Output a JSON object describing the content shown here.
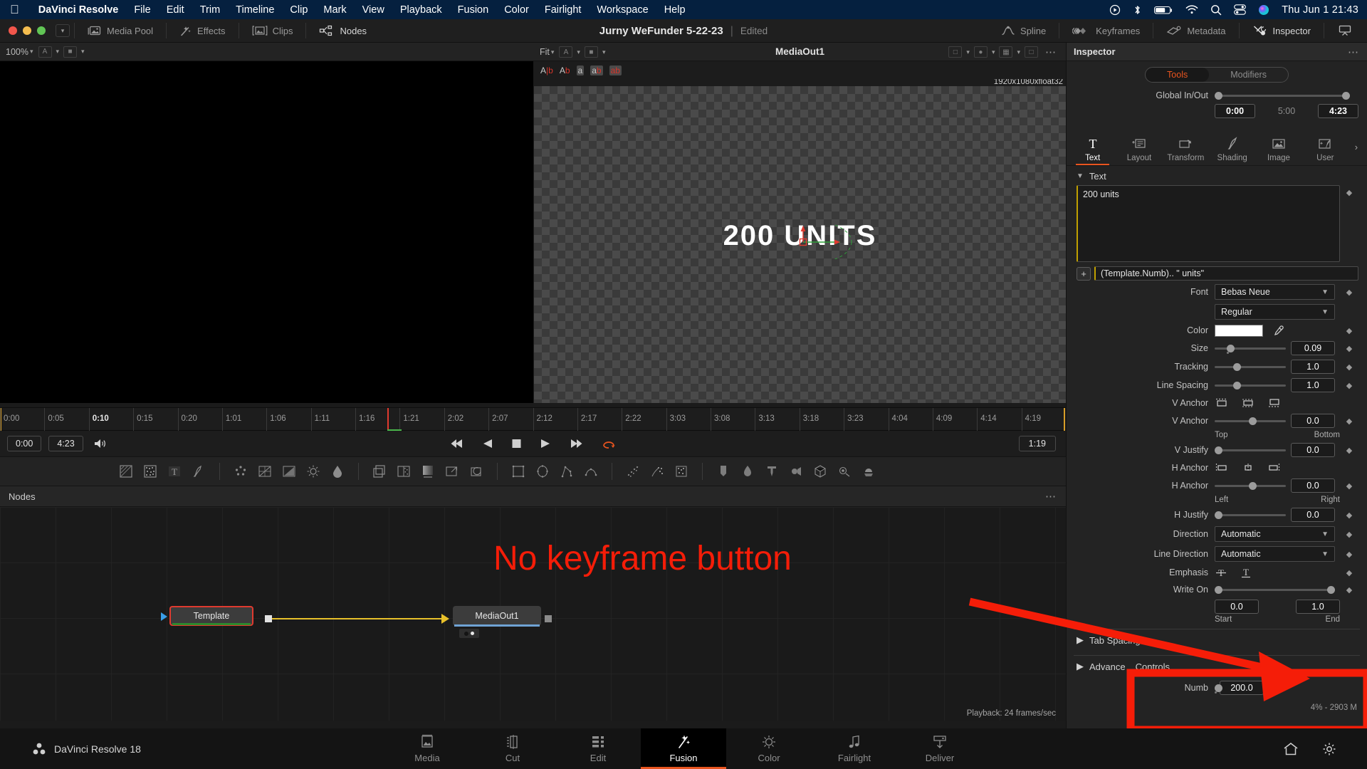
{
  "macbar": {
    "apple_icon": "apple-logo-icon",
    "app_name": "DaVinci Resolve",
    "menus": [
      "File",
      "Edit",
      "Trim",
      "Timeline",
      "Clip",
      "Mark",
      "View",
      "Playback",
      "Fusion",
      "Color",
      "Fairlight",
      "Workspace",
      "Help"
    ],
    "status_icons": [
      "screen-record-icon",
      "bluetooth-icon",
      "battery-icon",
      "wifi-icon",
      "search-icon",
      "control-center-icon",
      "siri-icon"
    ],
    "clock": "Thu Jun 1  21:43"
  },
  "topbar": {
    "buttons": [
      {
        "label": "Media Pool",
        "icon": "media-pool-icon"
      },
      {
        "label": "Effects",
        "icon": "effects-wand-icon"
      },
      {
        "label": "Clips",
        "icon": "clips-icon"
      },
      {
        "label": "Nodes",
        "icon": "nodes-icon"
      }
    ],
    "project_name": "Jurny WeFunder 5-22-23",
    "project_state": "Edited",
    "right_buttons": [
      {
        "label": "Spline",
        "icon": "spline-icon"
      },
      {
        "label": "Keyframes",
        "icon": "keyframes-icon"
      },
      {
        "label": "Metadata",
        "icon": "metadata-icon"
      },
      {
        "label": "Inspector",
        "icon": "inspector-icon"
      }
    ],
    "panel_toggle_icon": "panel-collapse-icon"
  },
  "subbar": {
    "zoom_left": "100%",
    "viewer_fit": "Fit",
    "viewer_title": "MediaOut1"
  },
  "viewer": {
    "ab_icons": [
      "a-b-split-icon",
      "a-b-stack-icon",
      "a-single-icon",
      "a-b-wipe-icon",
      "a-b-diff-icon"
    ],
    "resolution_label": "1920x1080xfloat32",
    "display_text": "200 UNITS"
  },
  "timeline": {
    "ticks": [
      "0:00",
      "0:05",
      "0:10",
      "0:15",
      "0:20",
      "1:01",
      "1:06",
      "1:11",
      "1:16",
      "1:21",
      "2:02",
      "2:07",
      "2:12",
      "2:17",
      "2:22",
      "3:03",
      "3:08",
      "3:13",
      "3:18",
      "3:23",
      "4:04",
      "4:09",
      "4:14",
      "4:19"
    ],
    "bold_tick": "0:10",
    "playhead_tick_index": 9,
    "in_timecode": "0:00",
    "out_timecode": "4:23",
    "current_timecode": "1:19"
  },
  "nodes": {
    "panel_title": "Nodes",
    "items": [
      {
        "label": "Template",
        "selected": true
      },
      {
        "label": "MediaOut1",
        "selected": false
      }
    ],
    "annotation": "No keyframe button",
    "playback_status": "Playback: 24 frames/sec"
  },
  "inspector": {
    "title": "Inspector",
    "tabs_mode": [
      "Tools",
      "Modifiers"
    ],
    "tabs_mode_active": "Tools",
    "global_in_out": {
      "label": "Global In/Out",
      "in": "0:00",
      "mid": "5:00",
      "out": "4:23"
    },
    "tool_tabs": [
      {
        "label": "Text",
        "icon": "text-tool-icon",
        "active": true
      },
      {
        "label": "Layout",
        "icon": "layout-tool-icon",
        "active": false
      },
      {
        "label": "Transform",
        "icon": "transform-tool-icon",
        "active": false
      },
      {
        "label": "Shading",
        "icon": "shading-brush-icon",
        "active": false
      },
      {
        "label": "Image",
        "icon": "image-tool-icon",
        "active": false
      },
      {
        "label": "User",
        "icon": "user-tool-icon",
        "active": false
      }
    ],
    "tool_tabs_more": "›",
    "text_section": {
      "header": "Text",
      "text_value": "200  units",
      "expression": "(Template.Numb).. \"  units\"",
      "font": "Bebas Neue",
      "font_style": "Regular",
      "color_label": "Color",
      "color_value": "#ffffff",
      "rows": [
        {
          "label": "Size",
          "value": "0.09",
          "knob": 0.17
        },
        {
          "label": "Tracking",
          "value": "1.0",
          "knob": 0.26
        },
        {
          "label": "Line Spacing",
          "value": "1.0",
          "knob": 0.26
        }
      ],
      "v_anchor_label": "V Anchor",
      "v_anchor_value": "0.0",
      "v_anchor_min": "Top",
      "v_anchor_max": "Bottom",
      "v_justify_label": "V Justify",
      "v_justify_value": "0.0",
      "h_anchor_label": "H Anchor",
      "h_anchor_value": "0.0",
      "h_anchor_min": "Left",
      "h_anchor_max": "Right",
      "h_justify_label": "H Justify",
      "h_justify_value": "0.0",
      "direction_label": "Direction",
      "direction_value": "Automatic",
      "line_direction_label": "Line Direction",
      "line_direction_value": "Automatic",
      "emphasis_label": "Emphasis",
      "write_on_label": "Write On",
      "write_on_start": "0.0",
      "write_on_end": "1.0",
      "write_on_start_label": "Start",
      "write_on_end_label": "End"
    },
    "tab_spacing_label": "Tab Spacing",
    "advanced_label": "Advance",
    "controls_label": "Controls",
    "controls_row": {
      "label": "Numb",
      "value": "200.0"
    },
    "memory_status": "4% - 2903 M",
    "font_label": "Font"
  },
  "taskbar": {
    "brand": "DaVinci Resolve 18",
    "pages": [
      {
        "label": "Media",
        "icon": "media-page-icon",
        "active": false
      },
      {
        "label": "Cut",
        "icon": "cut-page-icon",
        "active": false
      },
      {
        "label": "Edit",
        "icon": "edit-page-icon",
        "active": false
      },
      {
        "label": "Fusion",
        "icon": "fusion-page-icon",
        "active": true
      },
      {
        "label": "Color",
        "icon": "color-page-icon",
        "active": false
      },
      {
        "label": "Fairlight",
        "icon": "fairlight-page-icon",
        "active": false
      },
      {
        "label": "Deliver",
        "icon": "deliver-page-icon",
        "active": false
      }
    ],
    "right_icons": [
      "home-icon",
      "settings-gear-icon"
    ]
  },
  "colors": {
    "accent": "#e8541f",
    "annotation_red": "#f51d08",
    "wire_yellow": "#e8c02a",
    "menubar_blue": "#05203f"
  }
}
